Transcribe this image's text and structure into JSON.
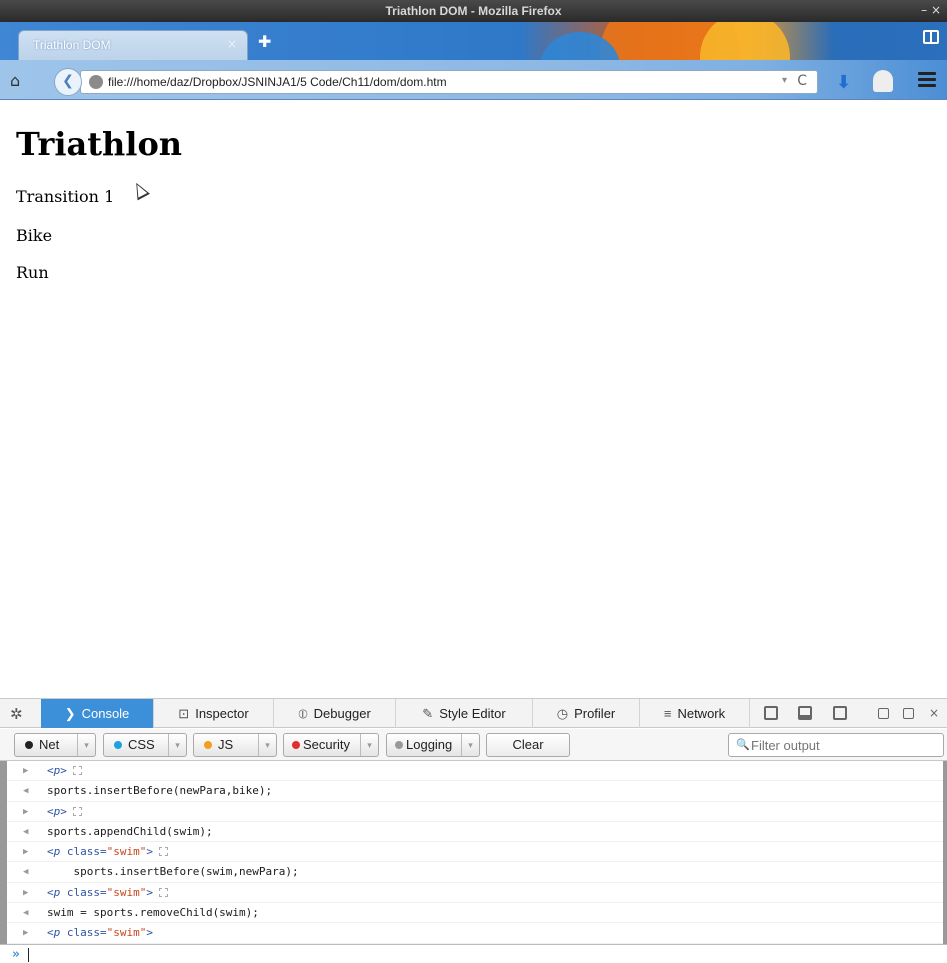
{
  "window": {
    "title": "Triathlon DOM - Mozilla Firefox",
    "controls": "– ×"
  },
  "tabs": [
    {
      "label": "Triathlon DOM",
      "close": "×"
    }
  ],
  "newtab": "✚",
  "nav": {
    "url": "file:///home/daz/Dropbox/JSNINJA1/5 Code/Ch11/dom/dom.htm",
    "reload": "C",
    "dropdown": "▾"
  },
  "page": {
    "heading": "Triathlon",
    "paragraphs": [
      "Transition 1",
      "Bike",
      "Run"
    ]
  },
  "devtools": {
    "tabs": [
      {
        "label": "Console",
        "icon": "❯"
      },
      {
        "label": "Inspector",
        "icon": "⊡"
      },
      {
        "label": "Debugger",
        "icon": "⦶"
      },
      {
        "label": "Style Editor",
        "icon": "✎"
      },
      {
        "label": "Profiler",
        "icon": "◷"
      },
      {
        "label": "Network",
        "icon": "≡"
      }
    ],
    "close": "×",
    "filters": [
      {
        "label": "Net",
        "color": "#222222"
      },
      {
        "label": "CSS",
        "color": "#1fa0e0"
      },
      {
        "label": "JS",
        "color": "#f0a020"
      },
      {
        "label": "Security",
        "color": "#e02f2f"
      },
      {
        "label": "Logging",
        "color": "#999999"
      }
    ],
    "clear": "Clear",
    "filter_placeholder": "Filter output",
    "prompt": "»"
  },
  "console_lines": [
    {
      "kind": "out",
      "text": "<p>"
    },
    {
      "kind": "in",
      "text": "sports.insertBefore(newPara,bike);"
    },
    {
      "kind": "out",
      "text": "<p>"
    },
    {
      "kind": "in",
      "text": "sports.appendChild(swim);"
    },
    {
      "kind": "out",
      "text": "<p class=\"swim\">"
    },
    {
      "kind": "in",
      "text": "    sports.insertBefore(swim,newPara);"
    },
    {
      "kind": "out",
      "text": "<p class=\"swim\">"
    },
    {
      "kind": "in",
      "text": "swim = sports.removeChild(swim);"
    },
    {
      "kind": "out",
      "text": "<p class=\"swim\">"
    }
  ]
}
